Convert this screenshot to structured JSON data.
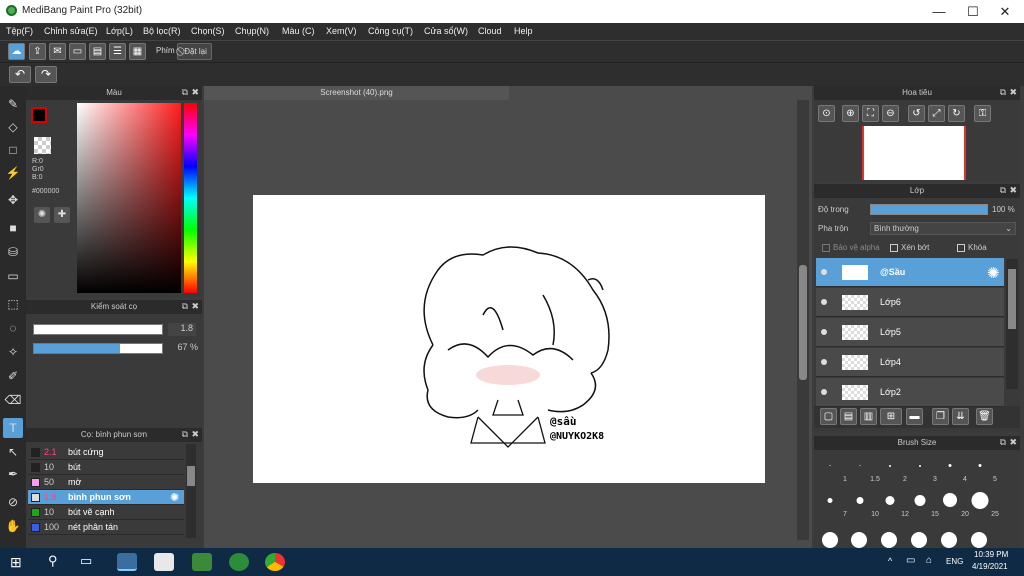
{
  "window": {
    "title": "MediBang Paint Pro (32bit)",
    "min": "—",
    "max": "☐",
    "close": "✕"
  },
  "menu": [
    "Tệp(F)",
    "Chỉnh sửa(E)",
    "Lớp(L)",
    "Bộ lọc(R)",
    "Chọn(S)",
    "Chụp(N)",
    "Màu (C)",
    "Xem(V)",
    "Công cụ(T)",
    "Cửa sổ(W)",
    "Cloud",
    "Help"
  ],
  "toolbar": {
    "phim_label": "Phím",
    "reset_label": "Đặt lại"
  },
  "color_panel": {
    "title": "Màu",
    "r": "R:0",
    "g": "Gr0",
    "b": "B:0",
    "hex": "#000000"
  },
  "brush_control": {
    "title": "Kiểm soát cọ",
    "size": "1.8",
    "opacity": "67 %",
    "opacity_fraction": 0.67
  },
  "brush_panel": {
    "title": "Cọ: bình phun sơn",
    "items": [
      {
        "size": "2.1",
        "name": "bút cứng",
        "color": "#222222"
      },
      {
        "size": "10",
        "name": "bút",
        "color": "#222222"
      },
      {
        "size": "50",
        "name": "mờ",
        "color": "#f49ff0"
      },
      {
        "size": "1.8",
        "name": "bình phun sơn",
        "color": "#dddddd"
      },
      {
        "size": "10",
        "name": "bút vẽ cạnh",
        "color": "#1aa81a"
      },
      {
        "size": "100",
        "name": "nét phân tán",
        "color": "#3a5fe0"
      }
    ]
  },
  "canvas": {
    "tab": "Screenshot (40).png",
    "sign1": "@sầu",
    "sign2": "@NUYKO2K8"
  },
  "navigator": {
    "title": "Hoa tiêu"
  },
  "layer_panel": {
    "title": "Lớp",
    "opacity_label": "Độ trong",
    "opacity_value": "100 %",
    "blend_label": "Pha trộn",
    "blend_value": "Bình thường",
    "protect_alpha": "Bảo vệ alpha",
    "clip": "Xén bớt",
    "lock": "Khóa",
    "layers": [
      "@Sầu",
      "Lớp6",
      "Lớp5",
      "Lớp4",
      "Lớp2"
    ]
  },
  "brush_size": {
    "title": "Brush Size",
    "sizes": [
      "1",
      "1.5",
      "2",
      "3",
      "4",
      "5",
      "7",
      "10",
      "12",
      "15",
      "20",
      "25"
    ]
  },
  "taskbar": {
    "lang": "ENG",
    "time": "10:39 PM",
    "date": "4/19/2021"
  },
  "colors": {
    "accent": "#5aa0d8",
    "panel": "#3a3a3a",
    "header": "#2b2b2b"
  }
}
